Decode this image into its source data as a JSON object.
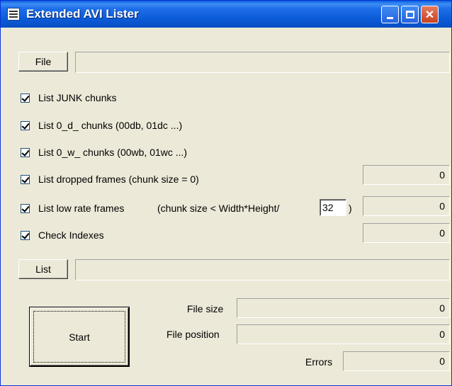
{
  "window": {
    "title": "Extended AVI Lister"
  },
  "file": {
    "button_label": "File",
    "path_value": ""
  },
  "options": [
    {
      "label": "List JUNK chunks",
      "checked": true
    },
    {
      "label": "List 0_d_ chunks (00db, 01dc ...)",
      "checked": true
    },
    {
      "label": "List 0_w_ chunks (00wb, 01wc ...)",
      "checked": true
    },
    {
      "label": "List dropped frames (chunk size = 0)",
      "checked": true,
      "count": "0"
    },
    {
      "label": "List low rate frames",
      "checked": true,
      "count": "0"
    },
    {
      "label": "Check Indexes",
      "checked": true,
      "count": "0"
    }
  ],
  "low_rate": {
    "prefix": "(chunk size < Width*Height/",
    "divisor": "32",
    "suffix": ")"
  },
  "list": {
    "button_label": "List",
    "output_value": ""
  },
  "start": {
    "button_label": "Start"
  },
  "stats": {
    "file_size_label": "File size",
    "file_size_value": "0",
    "file_position_label": "File position",
    "file_position_value": "0",
    "errors_label": "Errors",
    "errors_value": "0"
  }
}
